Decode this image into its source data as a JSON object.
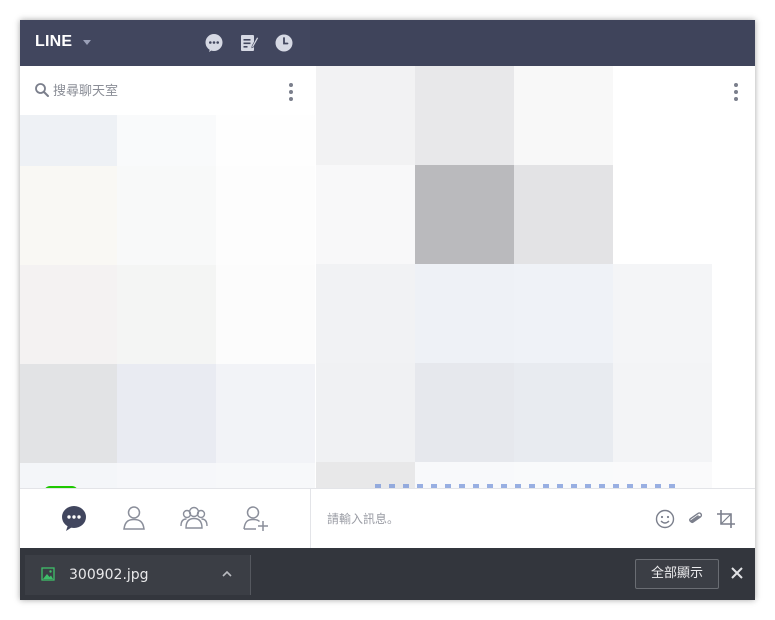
{
  "app": {
    "brand": "LINE"
  },
  "topbar": {
    "icons": [
      "chat-icon",
      "note-icon",
      "clock-icon"
    ]
  },
  "chat_list": {
    "search_placeholder": "搜尋聊天室",
    "menu_icon": "kebab-icon"
  },
  "chat_room": {
    "menu_icon": "kebab-icon",
    "message_placeholder": "請輸入訊息。",
    "toolbar_icons": [
      "emoji-icon",
      "attach-icon",
      "crop-icon"
    ]
  },
  "bottom_nav": {
    "items": [
      "chats-icon",
      "friend-icon",
      "groups-icon",
      "add-friend-icon"
    ],
    "active_color": "#41465e"
  },
  "download_shelf": {
    "file_name": "300902.jpg",
    "show_all_label": "全部顯示",
    "close_icon": "close-icon"
  },
  "colors": {
    "topbar": "#41465e",
    "line_green": "#1ec800",
    "shelf": "#33363d"
  }
}
